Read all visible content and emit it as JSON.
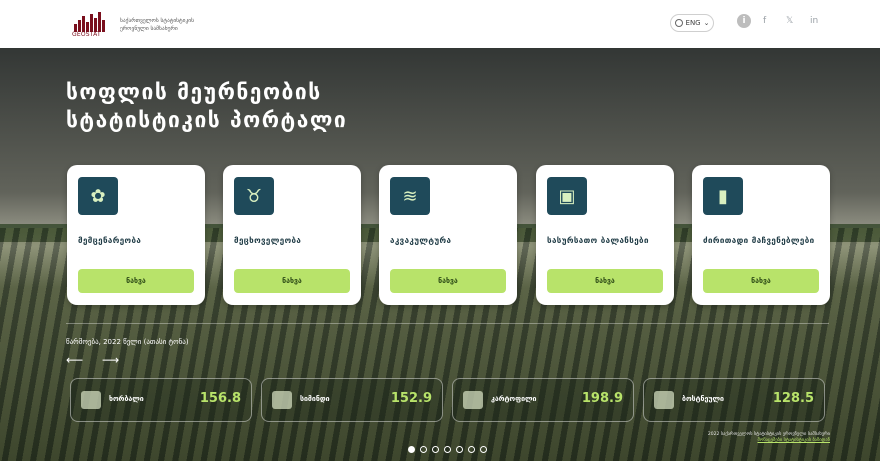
{
  "header": {
    "logo_small": "GEOSTAT",
    "title_line1": "საქართველოს სტატისტიკის",
    "title_line2": "ეროვნული სამსახური",
    "lang_label": "ENG",
    "social": [
      "f",
      "𝕏",
      "in"
    ]
  },
  "hero": {
    "title_line1": "სოფლის მეურნეობის",
    "title_line2": "სტატისტიკის პორტალი"
  },
  "cards": [
    {
      "label": "მემცენარეობა",
      "button": "ნახვა"
    },
    {
      "label": "მეცხოველეობა",
      "button": "ნახვა"
    },
    {
      "label": "აკვაკულტურა",
      "button": "ნახვა"
    },
    {
      "label": "სასურსათო ბალანსები",
      "button": "ნახვა"
    },
    {
      "label": "ძირითადი მაჩვენებლები",
      "button": "ნახვა"
    }
  ],
  "harvest": {
    "title": "წარმოება, 2022 წელი (ათასი ტონა)"
  },
  "stats": [
    {
      "name": "ხორბალი",
      "value": "156.8"
    },
    {
      "name": "სიმინდი",
      "value": "152.9"
    },
    {
      "name": "კარტოფილი",
      "value": "198.9"
    },
    {
      "name": "ბოსტნეული",
      "value": "128.5"
    }
  ],
  "footer": {
    "line1": "2022 საქართველოს სტატისტიკის ეროვნული სამსახური",
    "line2": "მონაცემები სტატისტიკის ბაზიდან"
  },
  "carousel": {
    "count": 7,
    "active": 0
  }
}
